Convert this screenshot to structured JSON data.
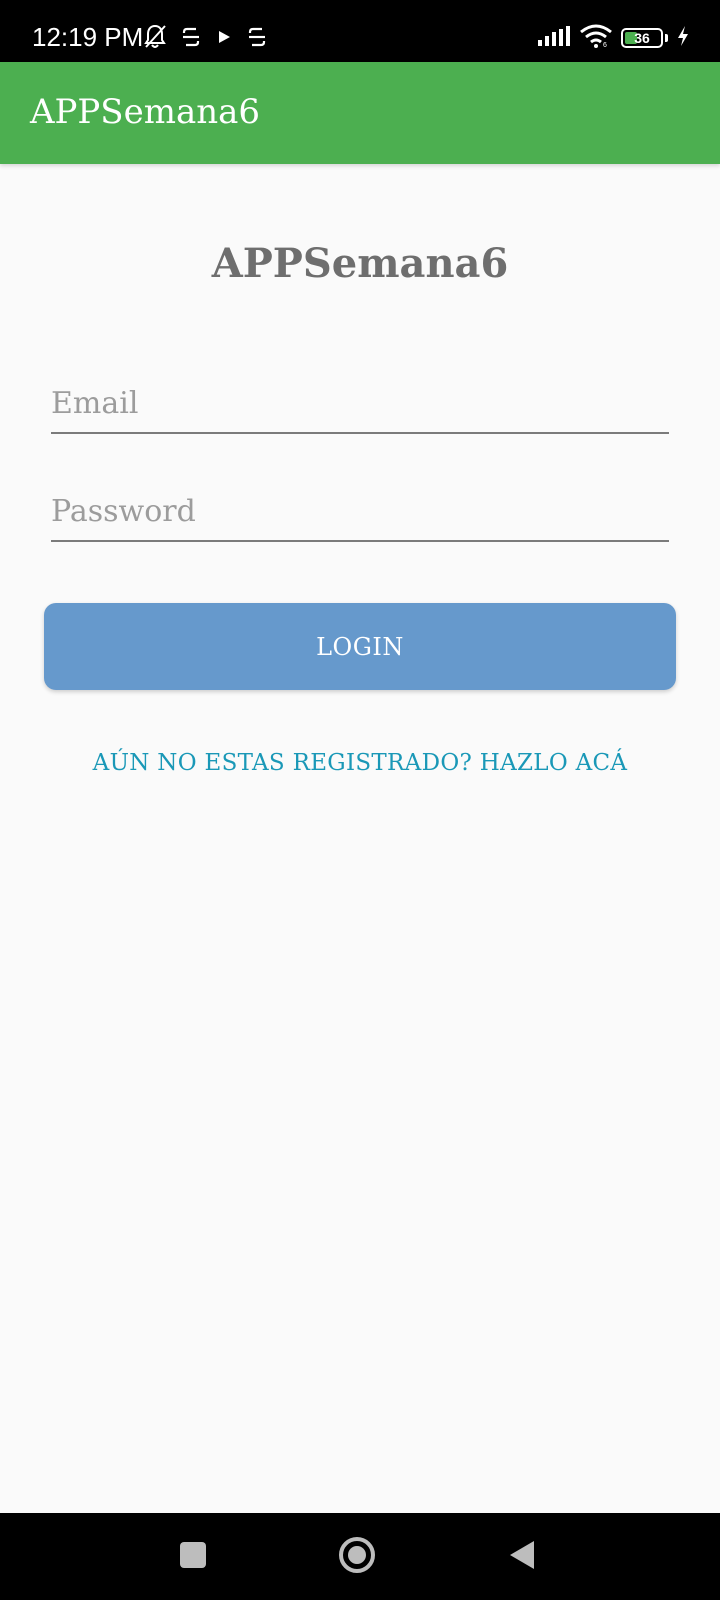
{
  "status_bar": {
    "time": "12:19 PM",
    "left_icons": [
      "notifications-off-icon",
      "app-notification-icon",
      "play-store-icon",
      "app-notification-icon"
    ],
    "right_icons": [
      "signal-icon",
      "wifi-icon",
      "battery-icon",
      "charging-icon"
    ],
    "battery_level": "36",
    "battery_fraction": 0.36
  },
  "app_bar": {
    "title": "APPSemana6",
    "color": "#4caf50"
  },
  "main": {
    "heading": "APPSemana6",
    "email": {
      "placeholder": "Email",
      "value": ""
    },
    "password": {
      "placeholder": "Password",
      "value": ""
    },
    "login_label": "LOGIN",
    "register_link": "AÚN NO ESTAS REGISTRADO? HAZLO ACÁ"
  },
  "nav_bar": {
    "buttons": [
      "recents-icon",
      "home-icon",
      "back-icon"
    ]
  },
  "colors": {
    "accent": "#4caf50",
    "button": "#6699cc",
    "link": "#1a98b7"
  }
}
